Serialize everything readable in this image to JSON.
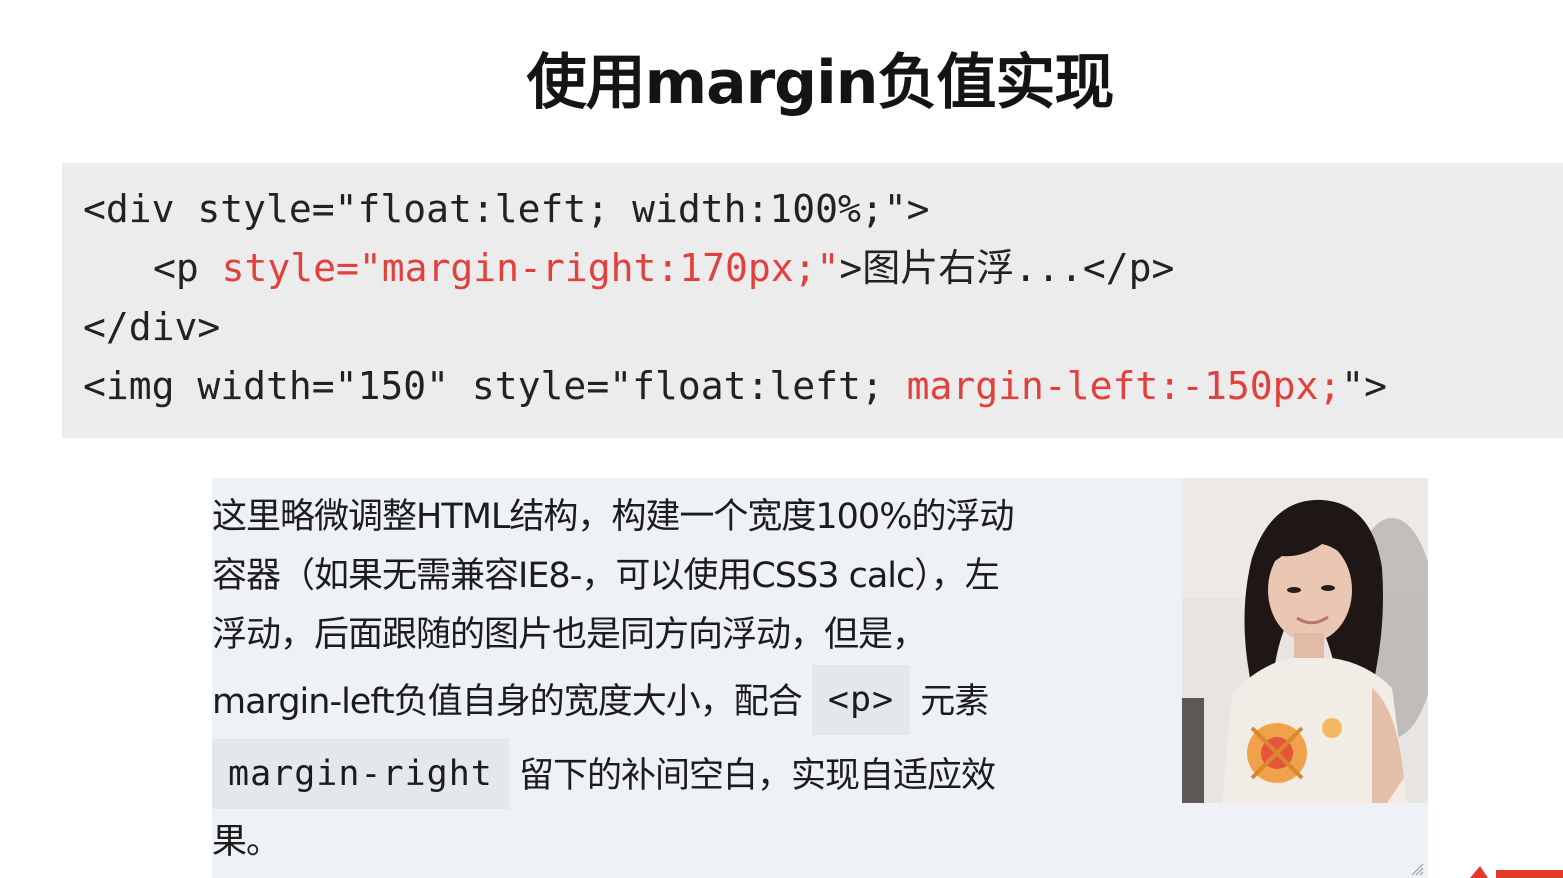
{
  "title": "使用margin负值实现",
  "code": {
    "line1": "<div style=\"float:left; width:100%;\">",
    "line2_prefix": "<p ",
    "line2_red": "style=\"margin-right:170px;\"",
    "line2_suffix": ">",
    "line2_cn": "图片右浮",
    "line2_end": "...</p>",
    "line3": "</div>",
    "line4_prefix": "<img width=\"150\" style=\"float:left; ",
    "line4_red": "margin-left:-150px;",
    "line4_suffix": "\">"
  },
  "demo": {
    "line1": "这里略微调整HTML结构，构建一个宽度100%的浮动",
    "line2": "容器（如果无需兼容IE8-，可以使用CSS3 calc），左",
    "line3": "浮动，后面跟随的图片也是同方向浮动，但是，",
    "line4_a": "margin-left负值自身的宽度大小，配合 ",
    "line4_code": "<p>",
    "line4_b": " 元素",
    "line5_code": "margin-right",
    "line5_b": " 留下的补间空白，实现自适应效",
    "line6": "果。"
  },
  "colors": {
    "code_background": "#ececec",
    "code_highlight": "#e2403c",
    "demo_background": "#eef1f6"
  }
}
